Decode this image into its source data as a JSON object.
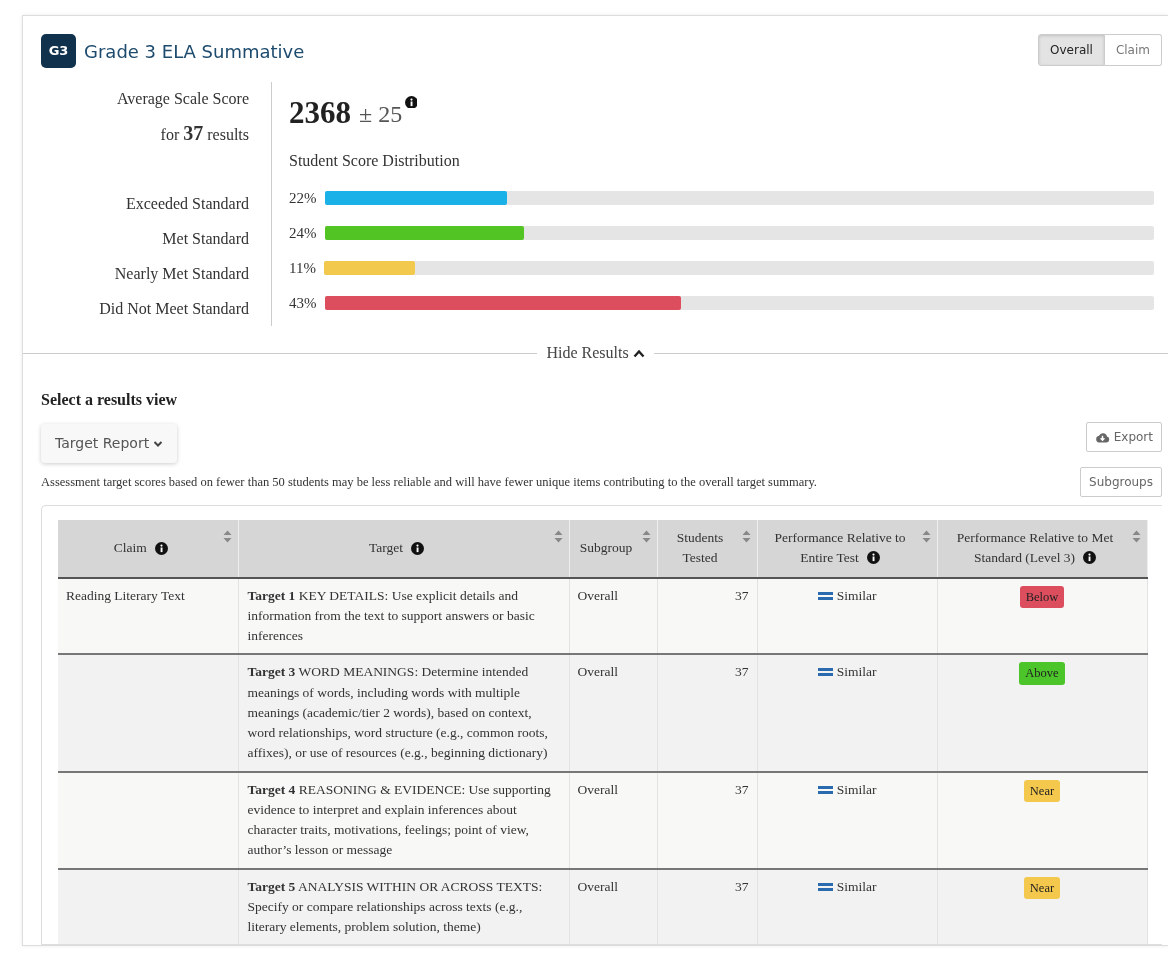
{
  "header": {
    "badge": "G3",
    "title": "Grade 3 ELA Summative",
    "view_toggle": [
      {
        "label": "Overall",
        "selected": true
      },
      {
        "label": "Claim",
        "selected": false
      }
    ]
  },
  "summary": {
    "label_line1": "Average Scale Score",
    "label_line2": "for **37** results",
    "score": "2368",
    "error": "± 25",
    "distribution_title": "Student Score Distribution",
    "distribution": [
      {
        "label": "Exceeded Standard",
        "percent": "22%",
        "level": 0.22,
        "color": "#1ab0e8"
      },
      {
        "label": "Met Standard",
        "percent": "24%",
        "level": 0.24,
        "color": "#52c423"
      },
      {
        "label": "Nearly Met Standard",
        "percent": "11%",
        "level": 0.11,
        "color": "#f2c94c"
      },
      {
        "label": "Did Not Meet Standard",
        "percent": "43%",
        "level": 0.43,
        "color": "#dc4e5e"
      }
    ]
  },
  "hide_results": "Hide Results",
  "results_view": {
    "heading": "Select a results view",
    "dropdown": "Target Report",
    "export": "Export",
    "note": "Assessment target scores based on fewer than 50 students may be less reliable and will have fewer unique items contributing to the overall target summary.",
    "subgroups": "Subgroups"
  },
  "table": {
    "columns": [
      {
        "label": "Claim",
        "info": true
      },
      {
        "label": "Target",
        "info": true
      },
      {
        "label": "Subgroup",
        "info": false
      },
      {
        "label": "Students Tested",
        "info": false
      },
      {
        "label": "Performance Relative to Entire Test",
        "info": true
      },
      {
        "label": "Performance Relative to Met Standard (Level 3)",
        "info": true
      }
    ],
    "rows": [
      {
        "claim": "Reading Literary Text",
        "target_number": "Target 1",
        "target_text": "KEY DETAILS: Use explicit details and information from the text to support answers or basic inferences",
        "subgroup": "Overall",
        "students_tested": "37",
        "relative_entire_test": "Similar",
        "relative_met": {
          "label": "Below",
          "kind": "below"
        }
      },
      {
        "target_number": "Target 3",
        "target_text": "WORD MEANINGS: Determine intended meanings of words, including words with multiple meanings (academic/tier 2 words), based on context, word relationships, word structure (e.g., common roots, affixes), or use of resources (e.g., beginning dictionary)",
        "subgroup": "Overall",
        "students_tested": "37",
        "relative_entire_test": "Similar",
        "relative_met": {
          "label": "Above",
          "kind": "above"
        }
      },
      {
        "target_number": "Target 4",
        "target_text": "REASONING & EVIDENCE: Use supporting evidence to interpret and explain inferences about character traits, motivations, feelings; point of view, author’s lesson or message",
        "subgroup": "Overall",
        "students_tested": "37",
        "relative_entire_test": "Similar",
        "relative_met": {
          "label": "Near",
          "kind": "near"
        }
      },
      {
        "target_number": "Target 5",
        "target_text": "ANALYSIS WITHIN OR ACROSS TEXTS: Specify or compare relationships across texts (e.g., literary elements, problem solution, theme)",
        "subgroup": "Overall",
        "students_tested": "37",
        "relative_entire_test": "Similar",
        "relative_met": {
          "label": "Near",
          "kind": "near"
        }
      }
    ]
  }
}
